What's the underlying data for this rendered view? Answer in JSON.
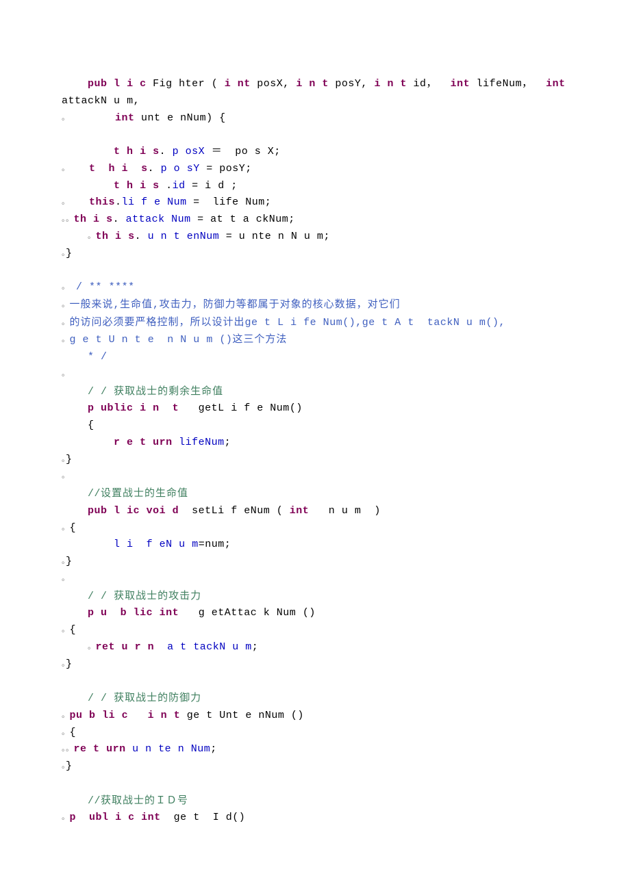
{
  "lines": [
    [
      [
        "    "
      ],
      [
        "kw",
        "pub"
      ],
      [
        " "
      ],
      [
        "kw",
        "l"
      ],
      [
        " "
      ],
      [
        "kw",
        "i"
      ],
      [
        " "
      ],
      [
        "kw",
        "c"
      ],
      [
        " "
      ],
      [
        "id",
        "Fig"
      ],
      [
        " "
      ],
      [
        "id",
        "hter"
      ],
      [
        " ("
      ],
      [
        " "
      ],
      [
        "kw",
        "i"
      ],
      [
        " "
      ],
      [
        "kw",
        "nt"
      ],
      [
        " "
      ],
      [
        "id",
        "posX"
      ],
      [
        ", "
      ],
      [
        "kw",
        "i"
      ],
      [
        " "
      ],
      [
        "kw",
        "n"
      ],
      [
        " "
      ],
      [
        "kw",
        "t"
      ],
      [
        " "
      ],
      [
        "id",
        "posY"
      ],
      [
        ", "
      ],
      [
        "kw",
        "i"
      ],
      [
        " "
      ],
      [
        "kw",
        "n"
      ],
      [
        " "
      ],
      [
        "kw",
        "t"
      ],
      [
        " "
      ],
      [
        "id",
        "id"
      ],
      [
        "cn",
        "，"
      ],
      [
        "  "
      ],
      [
        "kw",
        "int"
      ],
      [
        " "
      ],
      [
        "id",
        "lifeNum"
      ],
      [
        "cn",
        "，"
      ],
      [
        "  "
      ],
      [
        "kw",
        "int"
      ]
    ],
    [
      [
        "id",
        "attackN"
      ],
      [
        " "
      ],
      [
        "id",
        "u"
      ],
      [
        " "
      ],
      [
        "id",
        "m"
      ],
      [
        ","
      ]
    ],
    [
      [
        "mk",
        "。"
      ],
      [
        "       "
      ],
      [
        "kw",
        "int"
      ],
      [
        " "
      ],
      [
        "id",
        "unt"
      ],
      [
        " "
      ],
      [
        "id",
        "e"
      ],
      [
        " "
      ],
      [
        "id",
        "nNum"
      ],
      [
        ") {"
      ]
    ],
    [
      [
        ""
      ]
    ],
    [
      [
        "        "
      ],
      [
        "kw",
        "t"
      ],
      [
        " "
      ],
      [
        "kw",
        "h"
      ],
      [
        " "
      ],
      [
        "kw",
        "i"
      ],
      [
        " "
      ],
      [
        "kw",
        "s"
      ],
      [
        ". "
      ],
      [
        "fld",
        "p"
      ],
      [
        " "
      ],
      [
        "fld",
        "osX"
      ],
      [
        " ＝  "
      ],
      [
        "id",
        "po"
      ],
      [
        " "
      ],
      [
        "id",
        "s"
      ],
      [
        " "
      ],
      [
        "id",
        "X"
      ],
      [
        ";"
      ]
    ],
    [
      [
        "mk",
        "。"
      ],
      [
        "   "
      ],
      [
        "kw",
        "t"
      ],
      [
        "  "
      ],
      [
        "kw",
        "h"
      ],
      [
        " "
      ],
      [
        "kw",
        "i"
      ],
      [
        "  "
      ],
      [
        "kw",
        "s"
      ],
      [
        ". "
      ],
      [
        "fld",
        "p"
      ],
      [
        " "
      ],
      [
        "fld",
        "o"
      ],
      [
        " "
      ],
      [
        "fld",
        "s"
      ],
      [
        "fld",
        "Y"
      ],
      [
        " = "
      ],
      [
        "id",
        "posY"
      ],
      [
        ";"
      ]
    ],
    [
      [
        "        "
      ],
      [
        "kw",
        "t"
      ],
      [
        " "
      ],
      [
        "kw",
        "h"
      ],
      [
        " "
      ],
      [
        "kw",
        "i"
      ],
      [
        " "
      ],
      [
        "kw",
        "s"
      ],
      [
        " ."
      ],
      [
        "fld",
        "id"
      ],
      [
        " = "
      ],
      [
        "id",
        "i"
      ],
      [
        " "
      ],
      [
        "id",
        "d"
      ],
      [
        " ;"
      ]
    ],
    [
      [
        "mk",
        "。"
      ],
      [
        "   "
      ],
      [
        "kw",
        "this"
      ],
      [
        "."
      ],
      [
        "fld",
        "li"
      ],
      [
        " "
      ],
      [
        "fld",
        "f"
      ],
      [
        " "
      ],
      [
        "fld",
        "e"
      ],
      [
        " "
      ],
      [
        "fld",
        "Num"
      ],
      [
        " =  "
      ],
      [
        "id",
        "life"
      ],
      [
        " "
      ],
      [
        "id",
        "N"
      ],
      [
        "id",
        "um"
      ],
      [
        ";"
      ]
    ],
    [
      [
        "mk",
        "。。"
      ],
      [
        "kw",
        "th"
      ],
      [
        " "
      ],
      [
        "kw",
        "i"
      ],
      [
        " "
      ],
      [
        "kw",
        "s"
      ],
      [
        ". "
      ],
      [
        "fld",
        "attack"
      ],
      [
        " "
      ],
      [
        "fld",
        "N"
      ],
      [
        "fld",
        "um"
      ],
      [
        " = "
      ],
      [
        "id",
        "at"
      ],
      [
        " "
      ],
      [
        "id",
        "t"
      ],
      [
        " "
      ],
      [
        "id",
        "a"
      ],
      [
        " "
      ],
      [
        "id",
        "ckNum"
      ],
      [
        ";"
      ]
    ],
    [
      [
        "    "
      ],
      [
        "mk",
        "。"
      ],
      [
        "kw",
        "th"
      ],
      [
        " "
      ],
      [
        "kw",
        "i"
      ],
      [
        " "
      ],
      [
        "kw",
        "s"
      ],
      [
        ". "
      ],
      [
        "fld",
        "u"
      ],
      [
        " "
      ],
      [
        "fld",
        "n"
      ],
      [
        " "
      ],
      [
        "fld",
        "t"
      ],
      [
        " "
      ],
      [
        "fld",
        "en"
      ],
      [
        "fld",
        "N"
      ],
      [
        "fld",
        "um"
      ],
      [
        " = "
      ],
      [
        "id",
        "u"
      ],
      [
        " "
      ],
      [
        "id",
        "nte"
      ],
      [
        " "
      ],
      [
        "id",
        "n"
      ],
      [
        " "
      ],
      [
        "id",
        "N"
      ],
      [
        " "
      ],
      [
        "id",
        "u"
      ],
      [
        " "
      ],
      [
        "id",
        "m"
      ],
      [
        ";"
      ]
    ],
    [
      [
        "mk",
        "。"
      ],
      [
        "}"
      ]
    ],
    [
      [
        ""
      ]
    ],
    [
      [
        "mk",
        "。"
      ],
      [
        " "
      ],
      [
        "doc",
        "/"
      ],
      [
        " "
      ],
      [
        "doc",
        "**"
      ],
      [
        " "
      ],
      [
        "doc",
        "*"
      ],
      [
        "doc",
        "***"
      ]
    ],
    [
      [
        "mk",
        "。"
      ],
      [
        "doc cn",
        "一般来说"
      ],
      [
        "doc",
        ","
      ],
      [
        "doc cn",
        "生命值"
      ],
      [
        "doc",
        ","
      ],
      [
        "doc cn",
        "攻击力，防御力等都属于对象的核心数据，对它们"
      ]
    ],
    [
      [
        "mk",
        "。"
      ],
      [
        "doc cn",
        "的访问必须要严格控制，所以设计出"
      ],
      [
        "doc",
        "ge"
      ],
      [
        " "
      ],
      [
        "doc",
        "t"
      ],
      [
        " "
      ],
      [
        "doc",
        "L"
      ],
      [
        " "
      ],
      [
        "doc",
        "i"
      ],
      [
        " "
      ],
      [
        "doc",
        "fe"
      ],
      [
        " "
      ],
      [
        "doc",
        "N"
      ],
      [
        "doc",
        "um"
      ],
      [
        "doc",
        "()"
      ],
      [
        "doc",
        ","
      ],
      [
        "doc",
        "ge"
      ],
      [
        " "
      ],
      [
        "doc",
        "t"
      ],
      [
        " "
      ],
      [
        "doc",
        "A"
      ],
      [
        " "
      ],
      [
        "doc",
        "t"
      ],
      [
        "  "
      ],
      [
        "doc",
        "tackN"
      ],
      [
        " "
      ],
      [
        "doc",
        "u"
      ],
      [
        " "
      ],
      [
        "doc",
        "m"
      ],
      [
        "doc",
        "()"
      ],
      [
        "doc",
        ","
      ]
    ],
    [
      [
        "mk",
        "。"
      ],
      [
        "doc",
        "g"
      ],
      [
        " "
      ],
      [
        "doc",
        "e"
      ],
      [
        " "
      ],
      [
        "doc",
        "t"
      ],
      [
        " "
      ],
      [
        "doc",
        "U"
      ],
      [
        " "
      ],
      [
        "doc",
        "n"
      ],
      [
        " "
      ],
      [
        "doc",
        "t"
      ],
      [
        " "
      ],
      [
        "doc",
        "e"
      ],
      [
        "  "
      ],
      [
        "doc",
        "n"
      ],
      [
        " "
      ],
      [
        "doc",
        "N"
      ],
      [
        " "
      ],
      [
        "doc",
        "u"
      ],
      [
        " "
      ],
      [
        "doc",
        "m"
      ],
      [
        " "
      ],
      [
        "doc",
        "()"
      ],
      [
        "doc cn",
        "这三个方法"
      ]
    ],
    [
      [
        "    "
      ],
      [
        "doc",
        "*"
      ],
      [
        " "
      ],
      [
        "doc",
        "/"
      ]
    ],
    [
      [
        "mk",
        "。"
      ]
    ],
    [
      [
        "    "
      ],
      [
        "cmt",
        "/"
      ],
      [
        " "
      ],
      [
        "cmt",
        "/"
      ],
      [
        " "
      ],
      [
        "cmt cn",
        "获取战士的剩余生命值"
      ]
    ],
    [
      [
        "    "
      ],
      [
        "kw",
        "p"
      ],
      [
        " "
      ],
      [
        "kw",
        "ublic"
      ],
      [
        " "
      ],
      [
        "kw",
        "i"
      ],
      [
        " "
      ],
      [
        "kw",
        "n"
      ],
      [
        "  "
      ],
      [
        "kw",
        "t"
      ],
      [
        "   "
      ],
      [
        "id",
        "getL"
      ],
      [
        " "
      ],
      [
        "id",
        "i"
      ],
      [
        " "
      ],
      [
        "id",
        "f"
      ],
      [
        " "
      ],
      [
        "id",
        "e"
      ],
      [
        " "
      ],
      [
        "id",
        "Num"
      ],
      [
        "()"
      ]
    ],
    [
      [
        "    {"
      ]
    ],
    [
      [
        "        "
      ],
      [
        "kw",
        "r"
      ],
      [
        " "
      ],
      [
        "kw",
        "e"
      ],
      [
        " "
      ],
      [
        "kw",
        "t"
      ],
      [
        " "
      ],
      [
        "kw",
        "urn"
      ],
      [
        " "
      ],
      [
        "fld",
        "lifeNum"
      ],
      [
        ";"
      ]
    ],
    [
      [
        "mk",
        "。"
      ],
      [
        "}"
      ]
    ],
    [
      [
        "mk",
        "。"
      ]
    ],
    [
      [
        "    "
      ],
      [
        "cmt",
        "//"
      ],
      [
        "cmt cn",
        "设置战士的生命值"
      ]
    ],
    [
      [
        "    "
      ],
      [
        "kw",
        "pub"
      ],
      [
        " "
      ],
      [
        "kw",
        "l"
      ],
      [
        " "
      ],
      [
        "kw",
        "ic"
      ],
      [
        " "
      ],
      [
        "kw",
        "voi"
      ],
      [
        " "
      ],
      [
        "kw",
        "d"
      ],
      [
        "  "
      ],
      [
        "id",
        "setLi"
      ],
      [
        " "
      ],
      [
        "id",
        "f"
      ],
      [
        " "
      ],
      [
        "id",
        "eNum"
      ],
      [
        " ( "
      ],
      [
        "kw",
        "int"
      ],
      [
        "   "
      ],
      [
        "id",
        "n"
      ],
      [
        " "
      ],
      [
        "id",
        "u"
      ],
      [
        " "
      ],
      [
        "id",
        "m"
      ],
      [
        "  )"
      ]
    ],
    [
      [
        "mk",
        "。"
      ],
      [
        "{"
      ]
    ],
    [
      [
        "        "
      ],
      [
        "fld",
        "l"
      ],
      [
        " "
      ],
      [
        "fld",
        "i"
      ],
      [
        "  "
      ],
      [
        "fld",
        "f"
      ],
      [
        " "
      ],
      [
        "fld",
        "e"
      ],
      [
        "fld",
        "N"
      ],
      [
        " "
      ],
      [
        "fld",
        "u"
      ],
      [
        " "
      ],
      [
        "fld",
        "m"
      ],
      [
        "="
      ],
      [
        "id",
        "num"
      ],
      [
        ";"
      ]
    ],
    [
      [
        "mk",
        "。"
      ],
      [
        "}"
      ]
    ],
    [
      [
        "mk",
        "。"
      ]
    ],
    [
      [
        "    "
      ],
      [
        "cmt",
        "/"
      ],
      [
        " "
      ],
      [
        "cmt",
        "/"
      ],
      [
        " "
      ],
      [
        "cmt cn",
        "获取战士的攻击力"
      ]
    ],
    [
      [
        "    "
      ],
      [
        "kw",
        "p"
      ],
      [
        " "
      ],
      [
        "kw",
        "u"
      ],
      [
        "  "
      ],
      [
        "kw",
        "b"
      ],
      [
        " "
      ],
      [
        "kw",
        "l"
      ],
      [
        "kw",
        "i"
      ],
      [
        "kw",
        "c"
      ],
      [
        " "
      ],
      [
        "kw",
        "int"
      ],
      [
        "   "
      ],
      [
        "id",
        "g"
      ],
      [
        " "
      ],
      [
        "id",
        "etAttac"
      ],
      [
        " "
      ],
      [
        "id",
        "k"
      ],
      [
        " "
      ],
      [
        "id",
        "Num"
      ],
      [
        " ()"
      ]
    ],
    [
      [
        "mk",
        "。"
      ],
      [
        "{"
      ]
    ],
    [
      [
        "    "
      ],
      [
        "mk",
        "。"
      ],
      [
        "kw",
        "ret"
      ],
      [
        " "
      ],
      [
        "kw",
        "u"
      ],
      [
        " "
      ],
      [
        "kw",
        "r"
      ],
      [
        " "
      ],
      [
        "kw",
        "n"
      ],
      [
        "  "
      ],
      [
        "fld",
        "a"
      ],
      [
        " "
      ],
      [
        "fld",
        "t"
      ],
      [
        " "
      ],
      [
        "fld",
        "tackN"
      ],
      [
        " "
      ],
      [
        "fld",
        "u"
      ],
      [
        " "
      ],
      [
        "fld",
        "m"
      ],
      [
        ";"
      ]
    ],
    [
      [
        "mk",
        "。"
      ],
      [
        "}"
      ]
    ],
    [
      [
        ""
      ]
    ],
    [
      [
        "    "
      ],
      [
        "cmt",
        "/"
      ],
      [
        " "
      ],
      [
        "cmt",
        "/"
      ],
      [
        " "
      ],
      [
        "cmt cn",
        "获取战士的防御力"
      ]
    ],
    [
      [
        "mk",
        "。"
      ],
      [
        "kw",
        "pu"
      ],
      [
        " "
      ],
      [
        "kw",
        "b"
      ],
      [
        " "
      ],
      [
        "kw",
        "l"
      ],
      [
        "kw",
        "i"
      ],
      [
        " "
      ],
      [
        "kw",
        "c"
      ],
      [
        "   "
      ],
      [
        "kw",
        "i"
      ],
      [
        " "
      ],
      [
        "kw",
        "n"
      ],
      [
        " "
      ],
      [
        "kw",
        "t"
      ],
      [
        " "
      ],
      [
        "id",
        "ge"
      ],
      [
        " "
      ],
      [
        "id",
        "t"
      ],
      [
        " "
      ],
      [
        "id",
        "Unt"
      ],
      [
        " "
      ],
      [
        "id",
        "e"
      ],
      [
        " "
      ],
      [
        "id",
        "n"
      ],
      [
        "id",
        "Num"
      ],
      [
        " ()"
      ]
    ],
    [
      [
        "mk",
        "。"
      ],
      [
        "{"
      ]
    ],
    [
      [
        "mk",
        "。。"
      ],
      [
        "kw",
        "re"
      ],
      [
        " "
      ],
      [
        "kw",
        "t"
      ],
      [
        " "
      ],
      [
        "kw",
        "urn"
      ],
      [
        " "
      ],
      [
        "fld",
        "u"
      ],
      [
        " "
      ],
      [
        "fld",
        "n"
      ],
      [
        " "
      ],
      [
        "fld",
        "te"
      ],
      [
        " "
      ],
      [
        "fld",
        "n"
      ],
      [
        " "
      ],
      [
        "fld",
        "Num"
      ],
      [
        ";"
      ]
    ],
    [
      [
        "mk",
        "。"
      ],
      [
        "}"
      ]
    ],
    [
      [
        ""
      ]
    ],
    [
      [
        "    "
      ],
      [
        "cmt",
        "//"
      ],
      [
        "cmt cn",
        "获取战士的ＩＤ号"
      ]
    ],
    [
      [
        "mk",
        "。"
      ],
      [
        "kw",
        "p"
      ],
      [
        "  "
      ],
      [
        "kw",
        "u"
      ],
      [
        "kw",
        "bl"
      ],
      [
        " "
      ],
      [
        "kw",
        "i"
      ],
      [
        " "
      ],
      [
        "kw",
        "c"
      ],
      [
        " "
      ],
      [
        "kw",
        "int"
      ],
      [
        "  "
      ],
      [
        "id",
        "ge"
      ],
      [
        " "
      ],
      [
        "id",
        "t"
      ],
      [
        "  "
      ],
      [
        "id",
        "I"
      ],
      [
        " "
      ],
      [
        "id",
        "d"
      ],
      [
        "()"
      ]
    ]
  ]
}
